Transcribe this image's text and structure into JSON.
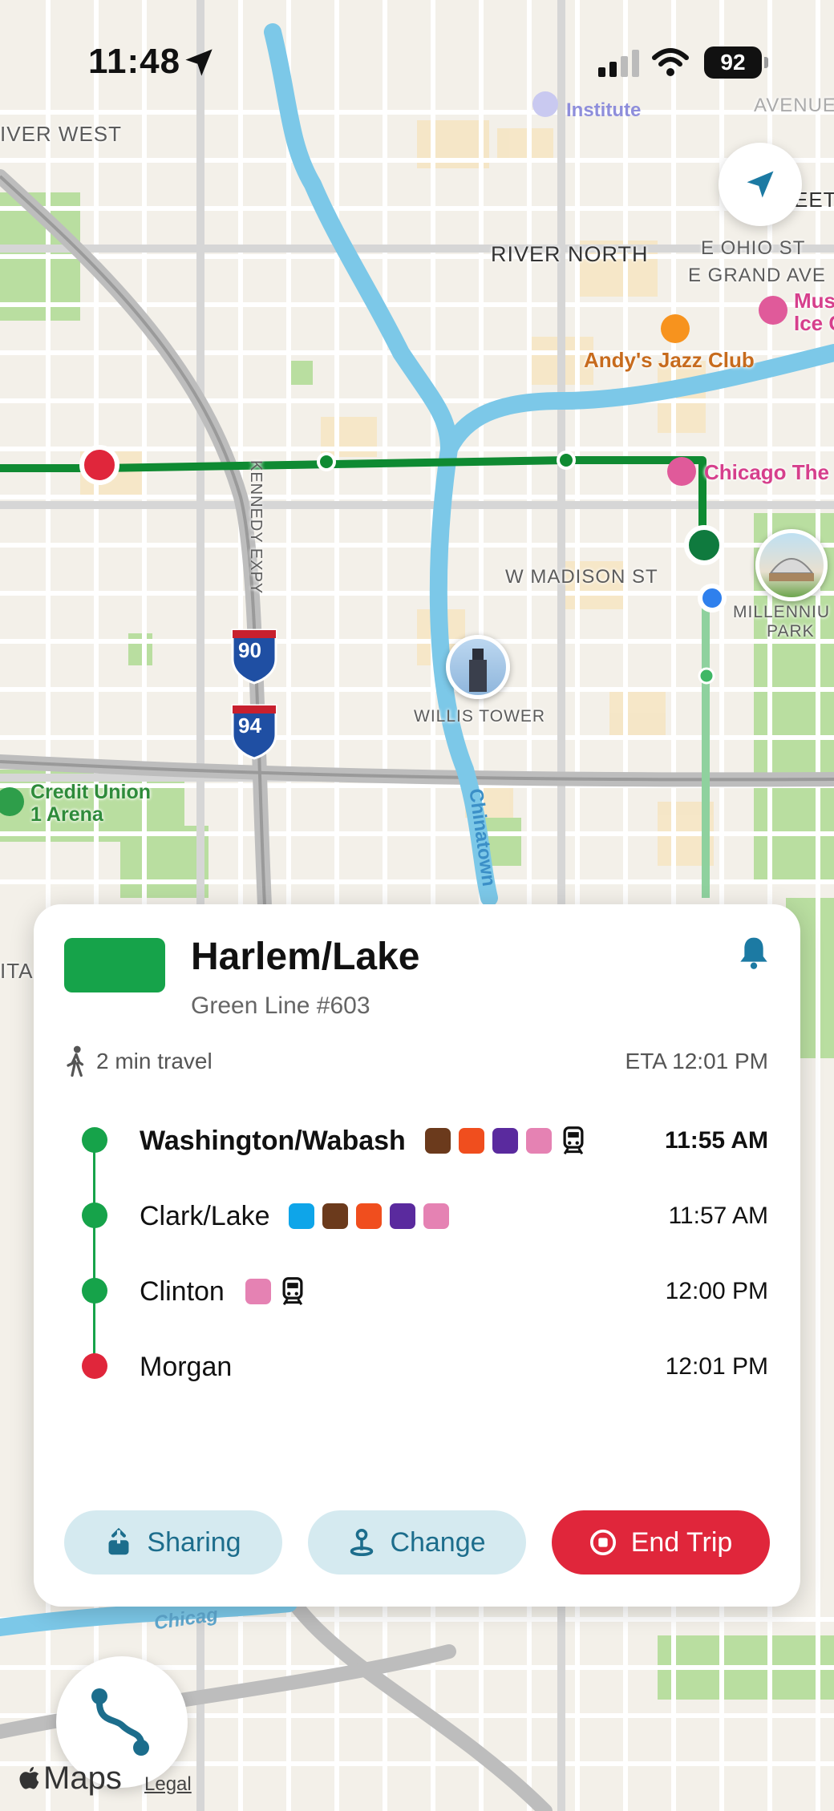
{
  "status_bar": {
    "time": "11:48",
    "battery": "92"
  },
  "map": {
    "labels": {
      "river_west": "IVER WEST",
      "institute": "Institute",
      "avenue": "AVENUE",
      "eet": "EET",
      "river_north": "RIVER NORTH",
      "e_ohio": "E OHIO ST",
      "e_grand": "E GRAND AVE",
      "mus": "Mus",
      "ice": "Ice C",
      "andys": "Andy's Jazz Club",
      "chicago_the": "Chicago The",
      "kennedy": "KENNEDY EXPY",
      "w_madison": "W MADISON ST",
      "millennium": "MILLENNIU",
      "park": "PARK",
      "willis": "WILLIS TOWER",
      "credit_union_1": "Credit Union",
      "credit_union_2": "1 Arena",
      "chinatown": "Chinatown",
      "ita": "ITA",
      "chicago_river": "Chicag",
      "i90": "90",
      "i94": "94"
    }
  },
  "trip": {
    "title": "Harlem/Lake",
    "subtitle": "Green Line #603",
    "travel": "2 min travel",
    "eta": "ETA 12:01 PM",
    "route_color": "#16a34a",
    "stops": [
      {
        "name": "Washington/Wabash",
        "time": "11:55 AM",
        "bold": true,
        "lines": [
          "#6b3a1c",
          "#f04e1e",
          "#5a2a9e",
          "#e582b3"
        ],
        "train": true,
        "dot": "#16a34a"
      },
      {
        "name": "Clark/Lake",
        "time": "11:57 AM",
        "bold": false,
        "lines": [
          "#0ea5e9",
          "#6b3a1c",
          "#f04e1e",
          "#5a2a9e",
          "#e582b3"
        ],
        "train": false,
        "dot": "#16a34a"
      },
      {
        "name": "Clinton",
        "time": "12:00 PM",
        "bold": false,
        "lines": [
          "#e582b3"
        ],
        "train": true,
        "dot": "#16a34a"
      },
      {
        "name": "Morgan",
        "time": "12:01 PM",
        "bold": false,
        "lines": [],
        "train": false,
        "dot": "#e0263b"
      }
    ]
  },
  "buttons": {
    "sharing": "Sharing",
    "change": "Change",
    "end_trip": "End Trip"
  },
  "footer": {
    "brand": "Maps",
    "legal": "Legal"
  }
}
